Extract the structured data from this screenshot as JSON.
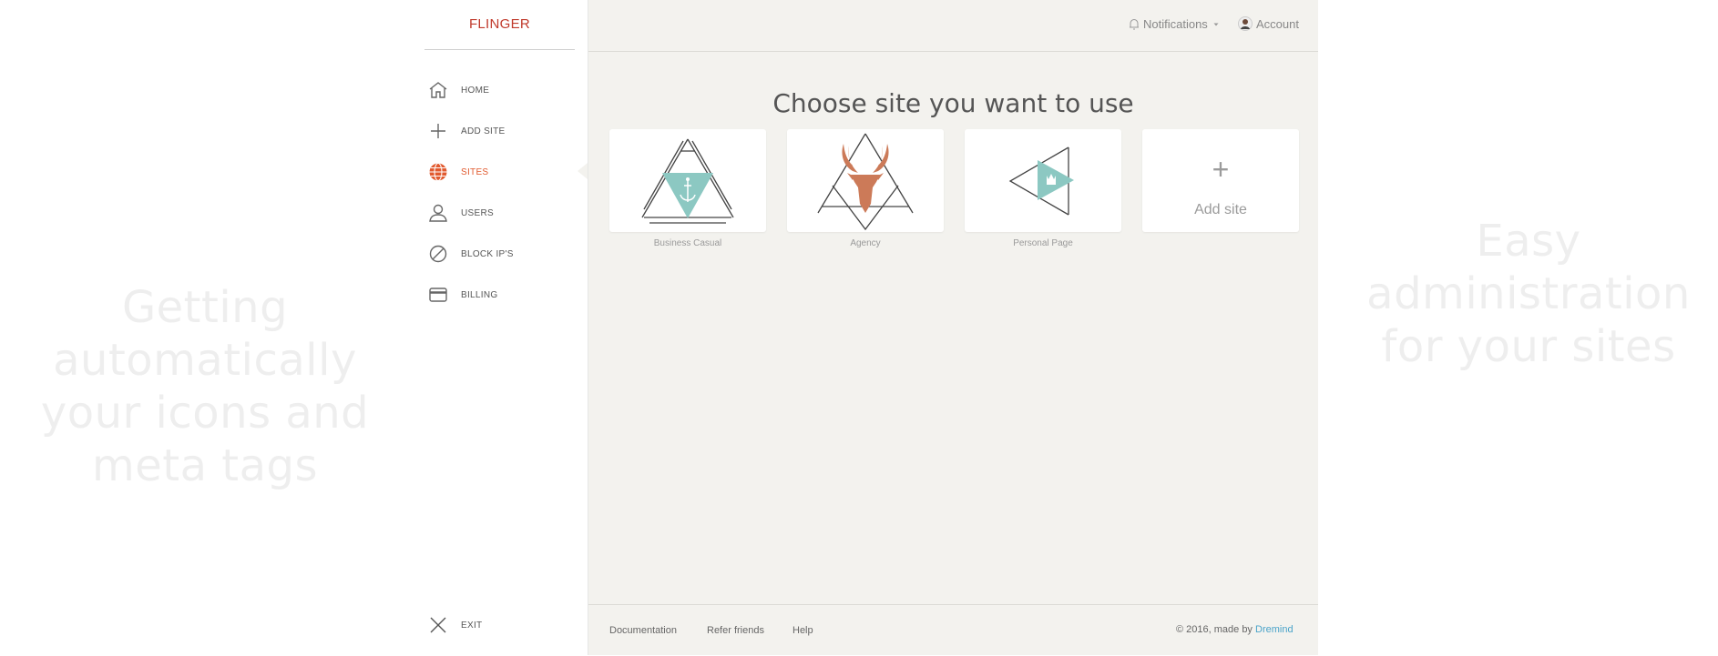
{
  "promo": {
    "left_text": "Getting automatically your icons and meta tags",
    "right_text": "Easy administration for your sites"
  },
  "sidebar": {
    "brand": "FLINGER",
    "items": [
      {
        "label": "HOME",
        "icon": "home-icon"
      },
      {
        "label": "ADD SITE",
        "icon": "plus-icon"
      },
      {
        "label": "SITES",
        "icon": "globe-icon",
        "active": true
      },
      {
        "label": "USERS",
        "icon": "user-icon"
      },
      {
        "label": "BLOCK IP'S",
        "icon": "block-icon"
      },
      {
        "label": "BILLING",
        "icon": "card-icon"
      }
    ],
    "exit_label": "EXIT"
  },
  "topbar": {
    "notifications": "Notifications",
    "account": "Account"
  },
  "main": {
    "heading": "Choose site you want to use",
    "sites": [
      {
        "name": "Business Casual",
        "logo": "anchor-triangle-logo"
      },
      {
        "name": "Agency",
        "logo": "deer-triangle-logo"
      },
      {
        "name": "Personal Page",
        "logo": "crown-play-logo"
      }
    ],
    "add_site_plus": "+",
    "add_site_label": "Add site"
  },
  "footer": {
    "links": [
      "Documentation",
      "Refer friends",
      "Help"
    ],
    "copyright": "© 2016, made by ",
    "author": "Dremind"
  },
  "colors": {
    "brand": "#c0392b",
    "active": "#e15a2f",
    "teal": "#8cc8c2",
    "deer": "#cc7a58",
    "link": "#4aa3c9",
    "background": "#f3f2ee"
  }
}
